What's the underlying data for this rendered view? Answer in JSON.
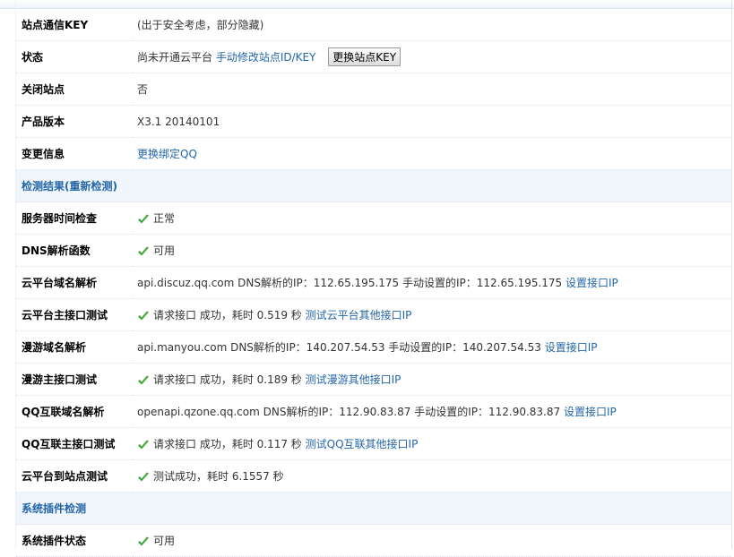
{
  "rows": [
    {
      "label": "站点通信KEY",
      "value": "(出于安全考虑，部分隐藏)"
    },
    {
      "label": "状态",
      "text": "尚未开通云平台",
      "link": "手动修改站点ID/KEY",
      "button": "更换站点KEY"
    },
    {
      "label": "关闭站点",
      "value": "否"
    },
    {
      "label": "产品版本",
      "value": "X3.1 20140101"
    },
    {
      "label": "变更信息",
      "link": "更换绑定QQ"
    }
  ],
  "section1": {
    "title": "检测结果(",
    "link": "重新检测",
    "close": ")"
  },
  "checks": [
    {
      "label": "服务器时间检查",
      "status": "正常"
    },
    {
      "label": "DNS解析函数",
      "status": "可用"
    },
    {
      "label": "云平台域名解析",
      "text": "api.discuz.qq.com DNS解析的IP：112.65.195.175 手动设置的IP：112.65.195.175",
      "link": "设置接口IP"
    },
    {
      "label": "云平台主接口测试",
      "text": "请求接口 成功，耗时 0.519 秒",
      "link": "测试云平台其他接口IP"
    },
    {
      "label": "漫游域名解析",
      "text": "api.manyou.com DNS解析的IP：140.207.54.53 手动设置的IP：140.207.54.53",
      "link": "设置接口IP"
    },
    {
      "label": "漫游主接口测试",
      "text": "请求接口 成功，耗时 0.189 秒",
      "link": "测试漫游其他接口IP"
    },
    {
      "label": "QQ互联域名解析",
      "text": "openapi.qzone.qq.com DNS解析的IP：112.90.83.87 手动设置的IP：112.90.83.87",
      "link": "设置接口IP"
    },
    {
      "label": "QQ互联主接口测试",
      "text": "请求接口 成功，耗时 0.117 秒",
      "link": "测试QQ互联其他接口IP"
    },
    {
      "label": "云平台到站点测试",
      "text": "测试成功，耗时 6.1557 秒"
    }
  ],
  "section2": {
    "title": "系统插件检测"
  },
  "plugins": [
    {
      "label": "系统插件状态",
      "status": "可用"
    }
  ],
  "icons": {
    "check": "check-icon"
  },
  "colors": {
    "link": "#2366a8",
    "section_bg": "#f0f6fb",
    "check": "#3fa83a"
  }
}
